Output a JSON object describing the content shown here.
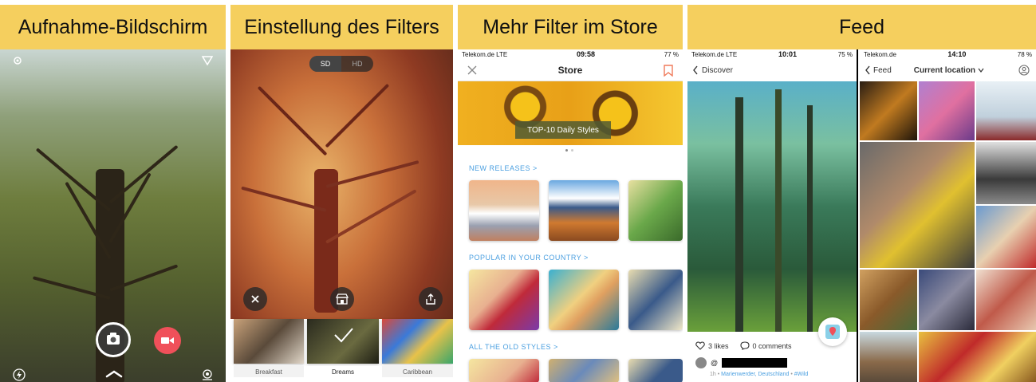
{
  "panels": {
    "capture": {
      "title": "Aufnahme-Bildschirm"
    },
    "filter": {
      "title": "Einstellung des Filters",
      "quality_sd": "SD",
      "quality_hd": "HD",
      "filters": [
        "Breakfast",
        "Dreams",
        "Caribbean"
      ]
    },
    "store": {
      "title": "Mehr Filter im Store",
      "status_carrier": "Telekom.de  LTE",
      "status_time": "09:58",
      "status_battery": "77 %",
      "nav_title": "Store",
      "banner_label": "TOP-10 Daily Styles",
      "section_new": "NEW RELEASES  >",
      "section_popular": "POPULAR IN YOUR COUNTRY  >",
      "section_old": "ALL THE OLD STYLES  >"
    },
    "feed": {
      "title": "Feed",
      "left": {
        "status_carrier": "Telekom.de  LTE",
        "status_time": "10:01",
        "status_battery": "75 %",
        "back_label": "Discover",
        "likes": "3 likes",
        "comments": "0 comments",
        "user_prefix": "@",
        "meta_time": "1h",
        "meta_location": "Marienwerder, Deutschland",
        "meta_tag": "#Wild"
      },
      "right": {
        "status_carrier": "Telekom.de",
        "status_time": "14:10",
        "status_battery": "78 %",
        "back_label": "Feed",
        "location_label": "Current location"
      }
    }
  },
  "colors": {
    "title_bg": "#f5cf5e",
    "accent_blue": "#4a9fe0",
    "record_red": "#f0505a",
    "bookmark_orange": "#f07a5a"
  }
}
